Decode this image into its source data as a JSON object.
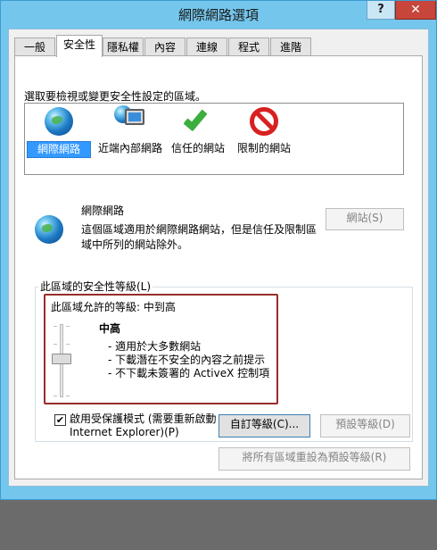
{
  "window": {
    "title": "網際網路選項",
    "help_label": "?",
    "close_label": "✕",
    "accent": "#74c6ec"
  },
  "tabs": [
    {
      "label": "一般"
    },
    {
      "label": "安全性"
    },
    {
      "label": "隱私權"
    },
    {
      "label": "內容"
    },
    {
      "label": "連線"
    },
    {
      "label": "程式"
    },
    {
      "label": "進階"
    }
  ],
  "security": {
    "zone_prompt": "選取要檢視或變更安全性設定的區域。",
    "zones": [
      {
        "label": "網際網路",
        "icon": "globe-icon"
      },
      {
        "label": "近端內部網路",
        "icon": "intranet-icon"
      },
      {
        "label": "信任的網站",
        "icon": "checkmark-icon"
      },
      {
        "label": "限制的網站",
        "icon": "no-entry-icon"
      }
    ],
    "selected_zone": {
      "name": "網際網路",
      "description": "這個區域適用於網際網路網站，但是信任及限制區域中所列的網站除外。",
      "sites_button": "網站(S)"
    },
    "level_group_title": "此區域的安全性等級(L)",
    "allowed_levels": "此區域允許的等級: 中到高",
    "level_name": "中高",
    "level_bullets": [
      "- 適用於大多數網站",
      "- 下載潛在不安全的內容之前提示",
      "- 不下載未簽署的 ActiveX 控制項"
    ],
    "protected_mode": {
      "checked": true,
      "check_glyph": "✔",
      "label": "啟用受保護模式 (需要重新啟動 Internet Explorer)(P)"
    },
    "custom_level_button": "自訂等級(C)...",
    "default_level_button": "預設等級(D)",
    "reset_all_button": "將所有區域重設為預設等級(R)"
  }
}
